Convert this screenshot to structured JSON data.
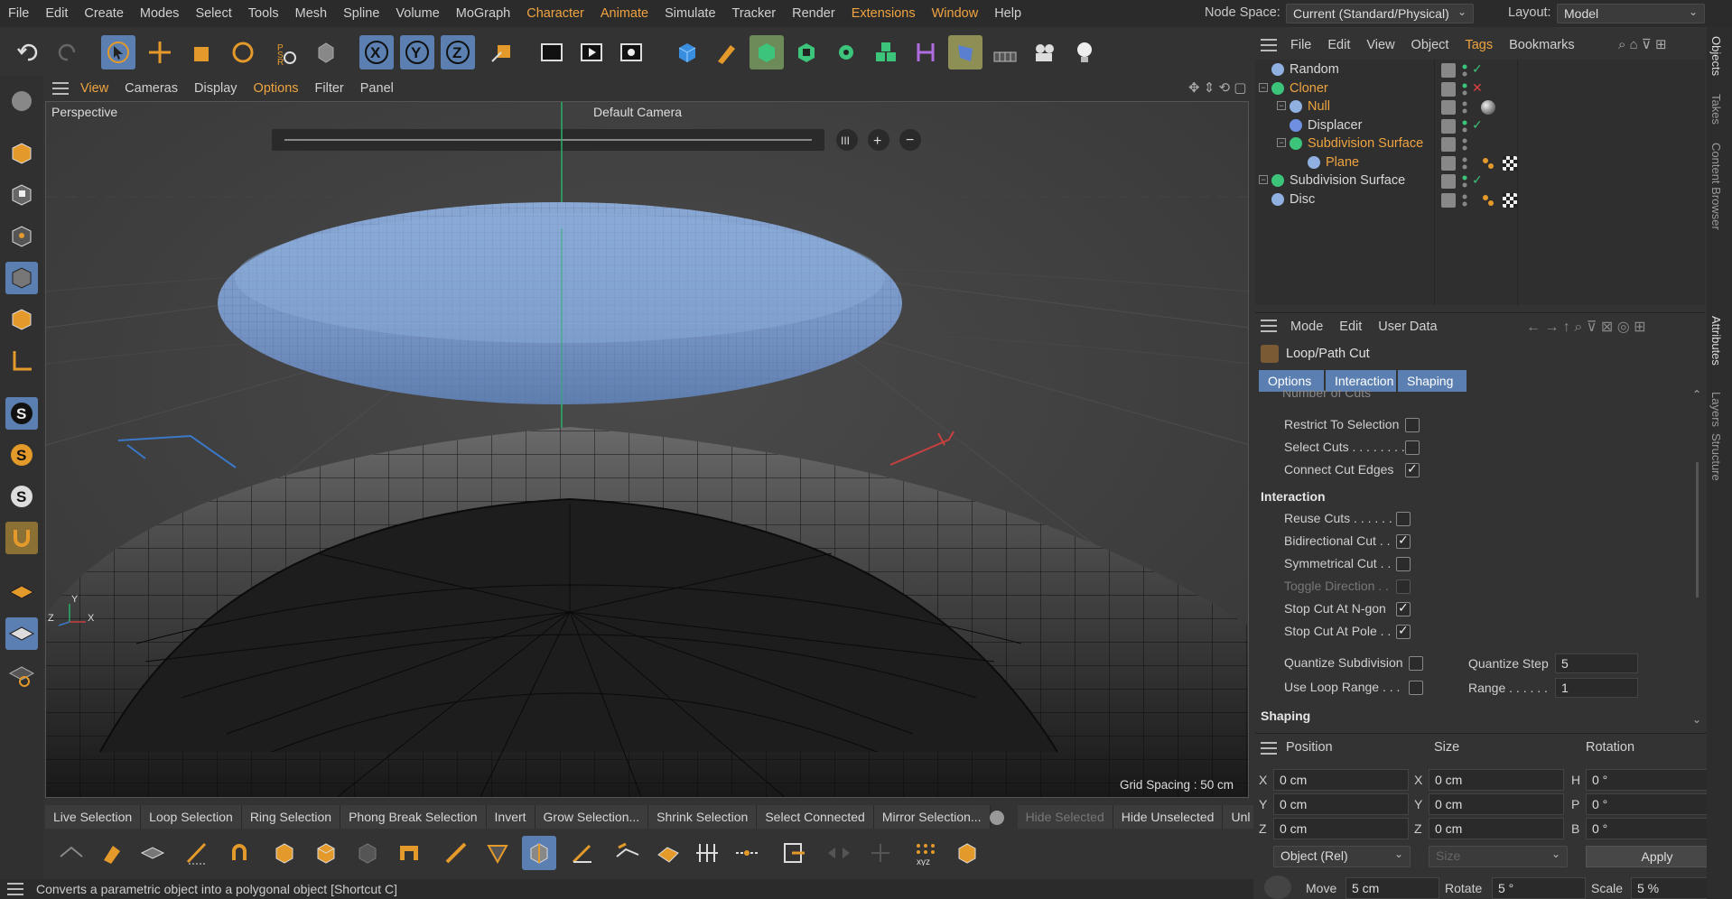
{
  "menubar": {
    "items": [
      {
        "label": "File",
        "accent": false
      },
      {
        "label": "Edit",
        "accent": false
      },
      {
        "label": "Create",
        "accent": false
      },
      {
        "label": "Modes",
        "accent": false
      },
      {
        "label": "Select",
        "accent": false
      },
      {
        "label": "Tools",
        "accent": false
      },
      {
        "label": "Mesh",
        "accent": false
      },
      {
        "label": "Spline",
        "accent": false
      },
      {
        "label": "Volume",
        "accent": false
      },
      {
        "label": "MoGraph",
        "accent": false
      },
      {
        "label": "Character",
        "accent": true
      },
      {
        "label": "Animate",
        "accent": true
      },
      {
        "label": "Simulate",
        "accent": false
      },
      {
        "label": "Tracker",
        "accent": false
      },
      {
        "label": "Render",
        "accent": false
      },
      {
        "label": "Extensions",
        "accent": true
      },
      {
        "label": "Window",
        "accent": true
      },
      {
        "label": "Help",
        "accent": false
      }
    ],
    "node_space_label": "Node Space:",
    "node_space_value": "Current (Standard/Physical)",
    "layout_label": "Layout:",
    "layout_value": "Model"
  },
  "viewport_menu": {
    "items": [
      {
        "label": "View",
        "accent": true
      },
      {
        "label": "Cameras",
        "accent": false
      },
      {
        "label": "Display",
        "accent": false
      },
      {
        "label": "Options",
        "accent": true
      },
      {
        "label": "Filter",
        "accent": false
      },
      {
        "label": "Panel",
        "accent": false
      }
    ]
  },
  "viewport": {
    "projection": "Perspective",
    "camera": "Default Camera",
    "grid_spacing": "Grid Spacing : 50 cm",
    "axis_x": "X",
    "axis_y": "Y",
    "axis_z": "Z"
  },
  "selection_bar": {
    "items": [
      {
        "label": "Live Selection",
        "disabled": false
      },
      {
        "label": "Loop Selection",
        "disabled": false
      },
      {
        "label": "Ring Selection",
        "disabled": false
      },
      {
        "label": "Phong Break Selection",
        "disabled": false
      },
      {
        "label": "Invert",
        "disabled": false
      },
      {
        "label": "Grow Selection...",
        "disabled": false
      },
      {
        "label": "Shrink Selection",
        "disabled": false
      },
      {
        "label": "Select Connected",
        "disabled": false
      },
      {
        "label": "Mirror Selection...",
        "disabled": false
      },
      {
        "label": "Hide Selected",
        "disabled": true
      },
      {
        "label": "Hide Unselected",
        "disabled": false
      },
      {
        "label": "Unl",
        "disabled": false
      }
    ]
  },
  "status_bar": {
    "text": "Converts a parametric object into a polygonal object [Shortcut C]"
  },
  "object_manager": {
    "menu": [
      {
        "label": "File",
        "accent": false
      },
      {
        "label": "Edit",
        "accent": false
      },
      {
        "label": "View",
        "accent": false
      },
      {
        "label": "Object",
        "accent": false
      },
      {
        "label": "Tags",
        "accent": true
      },
      {
        "label": "Bookmarks",
        "accent": false
      }
    ],
    "objects": [
      {
        "name": "Random",
        "accent": false,
        "icon": "random-effector-icon"
      },
      {
        "name": "Cloner",
        "accent": true,
        "icon": "cloner-icon"
      },
      {
        "name": "Null",
        "accent": true,
        "icon": "null-icon"
      },
      {
        "name": "Displacer",
        "accent": false,
        "icon": "displacer-icon"
      },
      {
        "name": "Subdivision Surface",
        "accent": true,
        "icon": "subdivision-surface-icon"
      },
      {
        "name": "Plane",
        "accent": true,
        "icon": "plane-icon"
      },
      {
        "name": "Subdivision Surface",
        "accent": false,
        "icon": "subdivision-surface-icon"
      },
      {
        "name": "Disc",
        "accent": false,
        "icon": "disc-icon"
      }
    ]
  },
  "attributes": {
    "menu": [
      {
        "label": "Mode"
      },
      {
        "label": "Edit"
      },
      {
        "label": "User Data"
      }
    ],
    "tool_title": "Loop/Path Cut",
    "tabs": [
      "Options",
      "Interaction",
      "Shaping"
    ],
    "partial_field": "Number of Cuts",
    "options": [
      {
        "label": "Restrict To Selection",
        "checked": false,
        "disabled": false
      },
      {
        "label": "Select Cuts . . . . . . . .",
        "checked": false,
        "disabled": false
      },
      {
        "label": "Connect Cut Edges",
        "checked": true,
        "disabled": false
      }
    ],
    "interaction_header": "Interaction",
    "interaction": [
      {
        "label": "Reuse Cuts . . . . . . .",
        "checked": false,
        "disabled": false
      },
      {
        "label": "Bidirectional Cut . .",
        "checked": true,
        "disabled": false
      },
      {
        "label": "Symmetrical Cut . .",
        "checked": false,
        "disabled": false
      },
      {
        "label": "Toggle Direction . .",
        "checked": false,
        "disabled": true
      },
      {
        "label": "Stop Cut At N-gon",
        "checked": true,
        "disabled": false
      },
      {
        "label": "Stop Cut At Pole . .",
        "checked": true,
        "disabled": false
      }
    ],
    "quantize_subdivision": {
      "label": "Quantize Subdivision",
      "checked": false
    },
    "use_loop_range": {
      "label": "Use Loop Range . . .",
      "checked": false
    },
    "quantize_step": {
      "label": "Quantize Step",
      "value": "5"
    },
    "range": {
      "label": "Range . . . . . .",
      "value": "1"
    },
    "shaping_header": "Shaping"
  },
  "coordinates": {
    "headers": {
      "position": "Position",
      "size": "Size",
      "rotation": "Rotation"
    },
    "position": [
      {
        "axis": "X",
        "value": "0 cm"
      },
      {
        "axis": "Y",
        "value": "0 cm"
      },
      {
        "axis": "Z",
        "value": "0 cm"
      }
    ],
    "size": [
      {
        "axis": "X",
        "value": "0 cm"
      },
      {
        "axis": "Y",
        "value": "0 cm"
      },
      {
        "axis": "Z",
        "value": "0 cm"
      }
    ],
    "rotation": [
      {
        "axis": "H",
        "value": "0 °"
      },
      {
        "axis": "P",
        "value": "0 °"
      },
      {
        "axis": "B",
        "value": "0 °"
      }
    ],
    "mode": "Object (Rel)",
    "size_mode": "Size",
    "apply": "Apply",
    "move_label": "Move",
    "move_value": "5 cm",
    "rotate_label": "Rotate",
    "rotate_value": "5 °",
    "scale_label": "Scale",
    "scale_value": "5 %"
  },
  "side_tabs": [
    "Objects",
    "Takes",
    "Content Browser",
    "Attributes",
    "Layers",
    "Structure"
  ],
  "colors": {
    "accent": "#f0a440",
    "highlight": "#5a7fb0",
    "background": "#333333"
  }
}
